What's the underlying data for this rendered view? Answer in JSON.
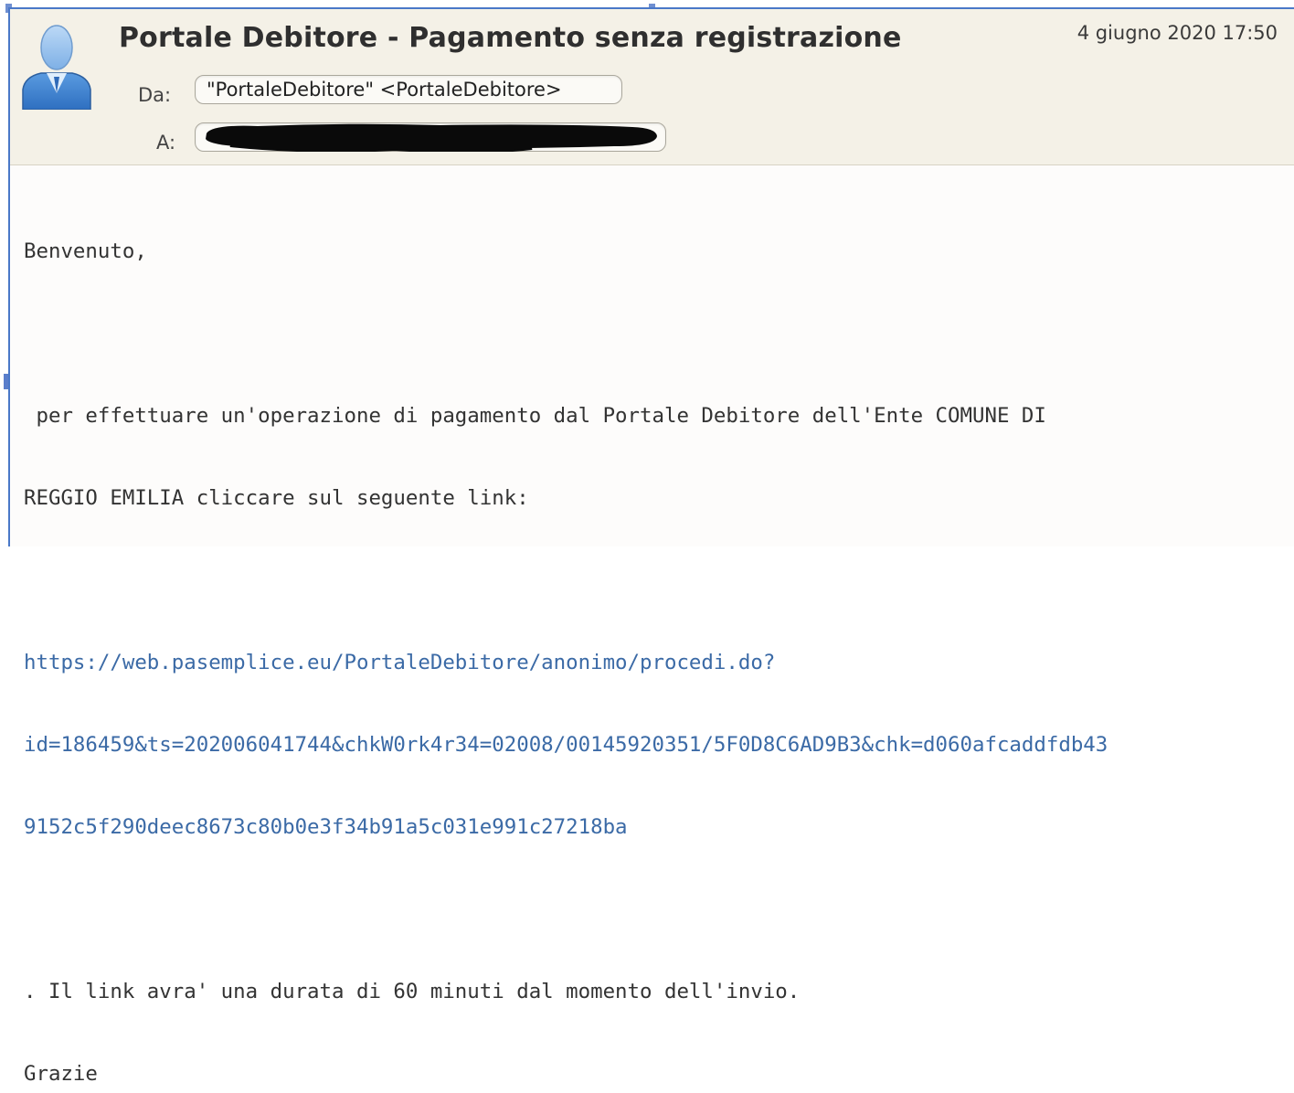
{
  "email": {
    "subject": "Portale Debitore - Pagamento senza registrazione",
    "date": "4 giugno 2020 17:50",
    "from_label": "Da:",
    "from_value": "\"PortaleDebitore\" <PortaleDebitore>",
    "to_label": "A:",
    "to_value": ""
  },
  "body": {
    "greeting": "Benvenuto,",
    "line1": " per effettuare un'operazione di pagamento dal Portale Debitore dell'Ente COMUNE DI",
    "line2": "REGGIO EMILIA cliccare sul seguente link:",
    "link_line1": "https://web.pasemplice.eu/PortaleDebitore/anonimo/procedi.do?",
    "link_line2": "id=186459&ts=202006041744&chkW0rk4r34=02008/00145920351/5F0D8C6AD9B3&chk=d060afcaddfdb43",
    "link_line3": "9152c5f290deec8673c80b0e3f34b91a5c031e991c27218ba",
    "note": ". Il link avra' una durata di 60 minuti dal momento dell'invio.",
    "closing": "Grazie"
  },
  "icons": {
    "avatar": "user-avatar-icon"
  },
  "colors": {
    "header_bg": "#f4f1e7",
    "link": "#3b6aa6",
    "frame": "#4a78c8"
  }
}
